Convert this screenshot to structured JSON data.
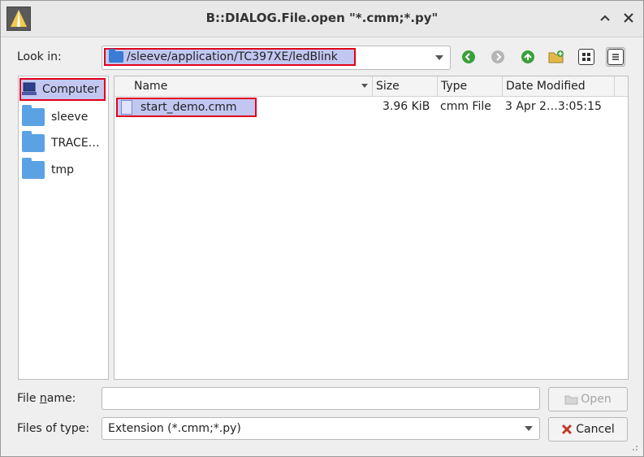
{
  "window": {
    "title": "B::DIALOG.File.open \"*.cmm;*.py\"",
    "controls": {
      "minimize": "^",
      "close": "✕"
    }
  },
  "toolbar": {
    "look_in_label": "Look in:",
    "path": "/sleeve/application/TC397XE/ledBlink",
    "icons": [
      "back-icon",
      "forward-icon",
      "up-icon",
      "new-folder-icon",
      "list-view-icon",
      "detail-view-icon"
    ]
  },
  "sidebar": {
    "items": [
      {
        "label": "Computer",
        "icon": "computer-icon",
        "selected": true
      },
      {
        "label": "sleeve",
        "icon": "folder-icon"
      },
      {
        "label": "TRACE…",
        "icon": "folder-icon"
      },
      {
        "label": "tmp",
        "icon": "folder-icon"
      }
    ]
  },
  "table": {
    "columns": [
      "Name",
      "Size",
      "Type",
      "Date Modified"
    ],
    "rows": [
      {
        "name": "start_demo.cmm",
        "size": "3.96 KiB",
        "type": "cmm File",
        "date": "3 Apr 2…3:05:15",
        "selected": true
      }
    ]
  },
  "filename": {
    "label_pre": "File ",
    "label_mnemonic": "n",
    "label_post": "ame:",
    "value": ""
  },
  "filetype": {
    "label": "Files of type:",
    "value": "Extension (*.cmm;*.py)"
  },
  "buttons": {
    "open": "Open",
    "cancel": "Cancel"
  },
  "colors": {
    "selection": "#c2c7f2",
    "highlight_border": "#e0001a",
    "folder": "#5aa2e3"
  }
}
